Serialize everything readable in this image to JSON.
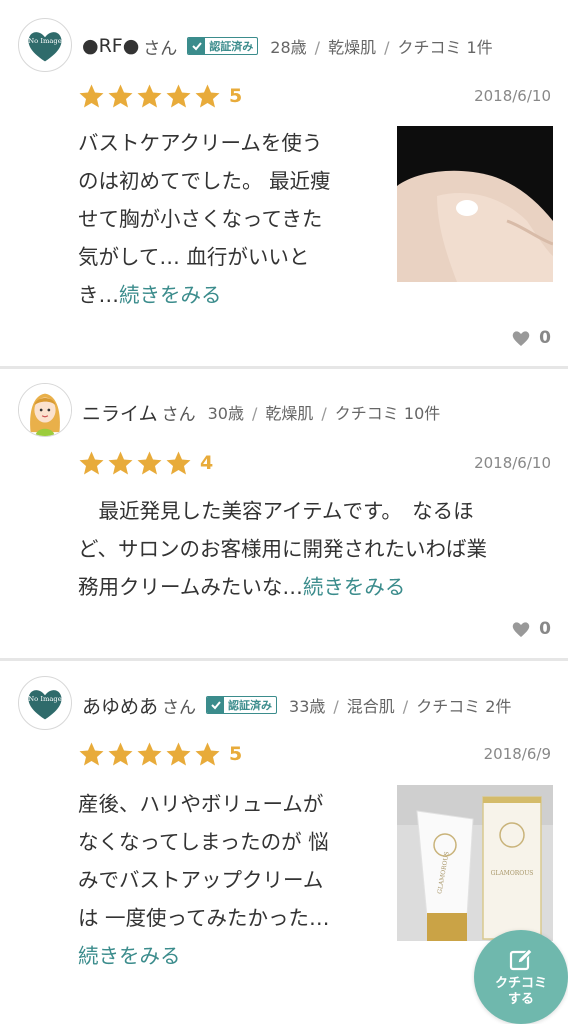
{
  "reviews": [
    {
      "avatar": "no-image-heart",
      "avatar_text": "No Image",
      "nickname": "●RF●",
      "san": "さん",
      "verified": true,
      "verified_label": "認証済み",
      "age": "28歳",
      "skin": "乾燥肌",
      "review_count": "クチコミ 1件",
      "rating": 5,
      "rating_label": "5",
      "date": "2018/6/10",
      "text": "バストケアクリームを使うのは初めてでした。 最近痩せて胸が小さくなってきた気がして… 血行がいいとき…",
      "lines": [
        "バストケアクリームを使う",
        "のは初めてでした。 最近痩",
        "せて胸が小さくなってきた",
        "気がして… 血行がいいと",
        "き…"
      ],
      "more": "続きをみる",
      "has_image": true,
      "likes": "0"
    },
    {
      "avatar": "illustration-girl",
      "nickname": "ニライム",
      "san": "さん",
      "verified": false,
      "age": "30歳",
      "skin": "乾燥肌",
      "review_count": "クチコミ 10件",
      "rating": 4,
      "rating_label": "4",
      "date": "2018/6/10",
      "text": "最近発見した美容アイテムです。 なるほど、サロンのお客様用に開発されたいわば業務用クリームみたいな…",
      "lines": [
        "　最近発見した美容アイテムです。　なるほ",
        "ど、サロンのお客様用に開発されたいわば業",
        "務用クリームみたいな…"
      ],
      "more": "続きをみる",
      "has_image": false,
      "likes": "0"
    },
    {
      "avatar": "no-image-heart",
      "avatar_text": "No Image",
      "nickname": "あゆめあ",
      "san": "さん",
      "verified": true,
      "verified_label": "認証済み",
      "age": "33歳",
      "skin": "混合肌",
      "review_count": "クチコミ 2件",
      "rating": 5,
      "rating_label": "5",
      "date": "2018/6/9",
      "text": "産後、ハリやボリュームがなくなってしまったのが 悩みでバストアップクリームは 一度使ってみたかった…",
      "lines": [
        "産後、ハリやボリュームが",
        "なくなってしまったのが 悩",
        "みでバストアップクリーム",
        "は 一度使ってみたかった…"
      ],
      "more": "続きをみる",
      "has_image": true,
      "product_text": "GLAMOROUS"
    }
  ],
  "fab": {
    "line1": "クチコミ",
    "line2": "する",
    "icon": "pencil-edit-icon"
  },
  "icons": {
    "like": "heart-icon",
    "star": "star-icon",
    "verified": "check-icon"
  },
  "colors": {
    "accent": "#3b8c8c",
    "star": "#e8ab3a",
    "fab": "#6fb8ad"
  }
}
